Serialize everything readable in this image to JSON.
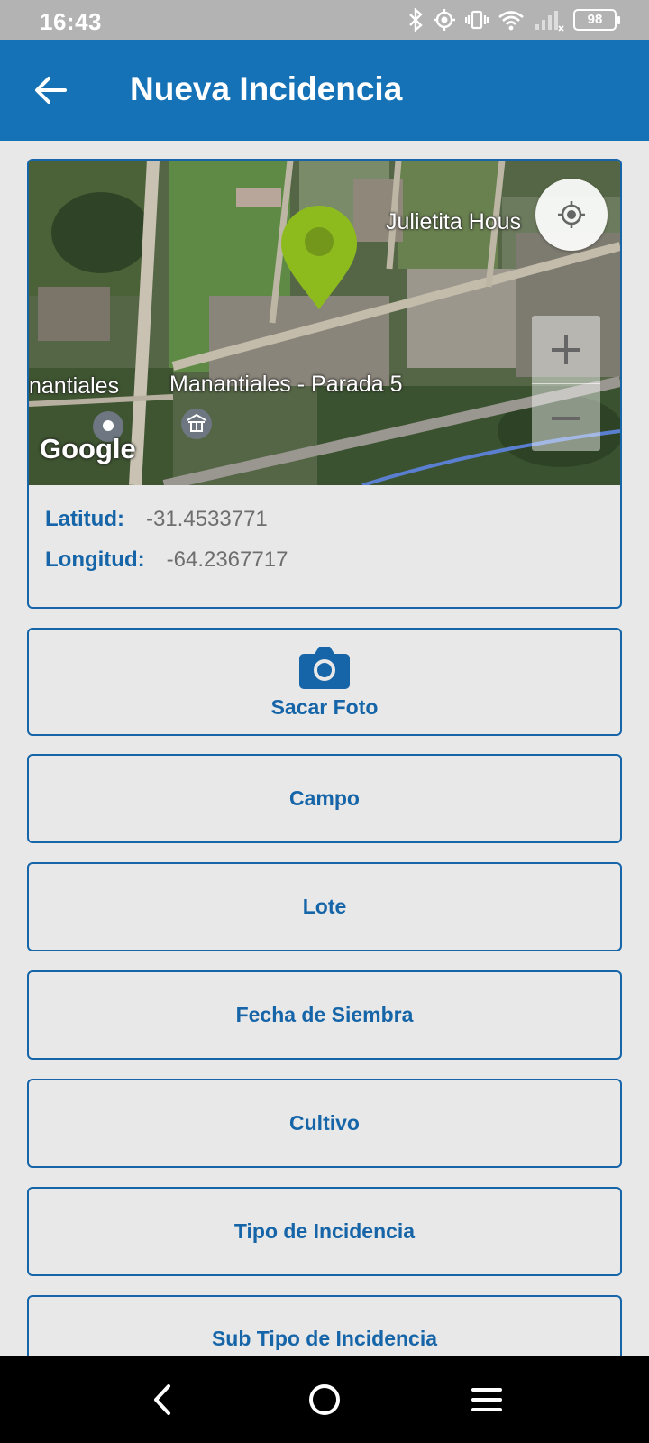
{
  "status_bar": {
    "time": "16:43",
    "battery": "98",
    "icons": [
      "bluetooth-icon",
      "location-icon",
      "vibrate-icon",
      "wifi-icon",
      "signal-icon",
      "battery-icon"
    ]
  },
  "app_bar": {
    "title": "Nueva Incidencia",
    "back_icon": "arrow-left-icon",
    "color": "#1572b6"
  },
  "map": {
    "labels": {
      "place_1": "Julietita Hous",
      "place_2": "nantiales",
      "place_3": "Manantiales - Parada 5",
      "brand": "Google"
    },
    "marker_color": "#8dbb1e",
    "controls": [
      "my-location-icon",
      "zoom-in-icon",
      "zoom-out-icon"
    ]
  },
  "location": {
    "lat_label": "Latitud:",
    "lat_value": "-31.4533771",
    "lon_label": "Longitud:",
    "lon_value": "-64.2367717"
  },
  "actions": {
    "photo": "Sacar Foto",
    "campo": "Campo",
    "lote": "Lote",
    "fecha_siembra": "Fecha de Siembra",
    "cultivo": "Cultivo",
    "tipo_incidencia": "Tipo de Incidencia",
    "sub_tipo_incidencia": "Sub Tipo de Incidencia"
  },
  "nav_bar": {
    "icons": [
      "nav-back-icon",
      "nav-home-icon",
      "nav-menu-icon"
    ]
  },
  "colors": {
    "accent": "#1565a8",
    "background": "#e8e8e8",
    "value_text": "#6e6e6e"
  }
}
